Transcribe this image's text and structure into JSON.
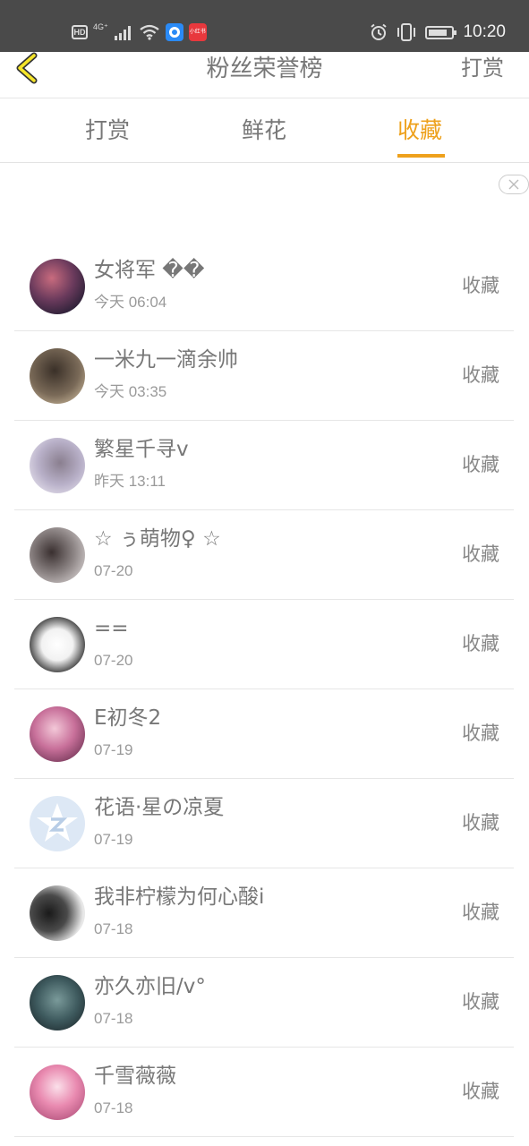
{
  "status_bar": {
    "time": "10:20",
    "network": "4G⁺",
    "hd": "HD",
    "app2_text": "小红书"
  },
  "header": {
    "title": "粉丝荣誉榜",
    "action": "打赏"
  },
  "tabs": [
    {
      "label": "打赏",
      "active": false
    },
    {
      "label": "鲜花",
      "active": false
    },
    {
      "label": "收藏",
      "active": true
    }
  ],
  "accent_color": "#eea11c",
  "items": [
    {
      "name": "女将军 ��",
      "time": "今天 06:04",
      "action": "收藏"
    },
    {
      "name": "一米九一滴余帅",
      "time": "今天 03:35",
      "action": "收藏"
    },
    {
      "name": "繁星千寻v",
      "time": "昨天 13:11",
      "action": "收藏"
    },
    {
      "name": "☆ ぅ萌物♀ ☆",
      "time": "07-20",
      "action": "收藏"
    },
    {
      "name": "==",
      "time": "07-20",
      "action": "收藏"
    },
    {
      "name": "E初冬2",
      "time": "07-19",
      "action": "收藏"
    },
    {
      "name": "花语·星の凉夏",
      "time": "07-19",
      "action": "收藏"
    },
    {
      "name": "我非柠檬为何心酸i",
      "time": "07-18",
      "action": "收藏"
    },
    {
      "name": "亦久亦旧/v°",
      "time": "07-18",
      "action": "收藏"
    },
    {
      "name": "千雪薇薇",
      "time": "07-18",
      "action": "收藏"
    }
  ]
}
